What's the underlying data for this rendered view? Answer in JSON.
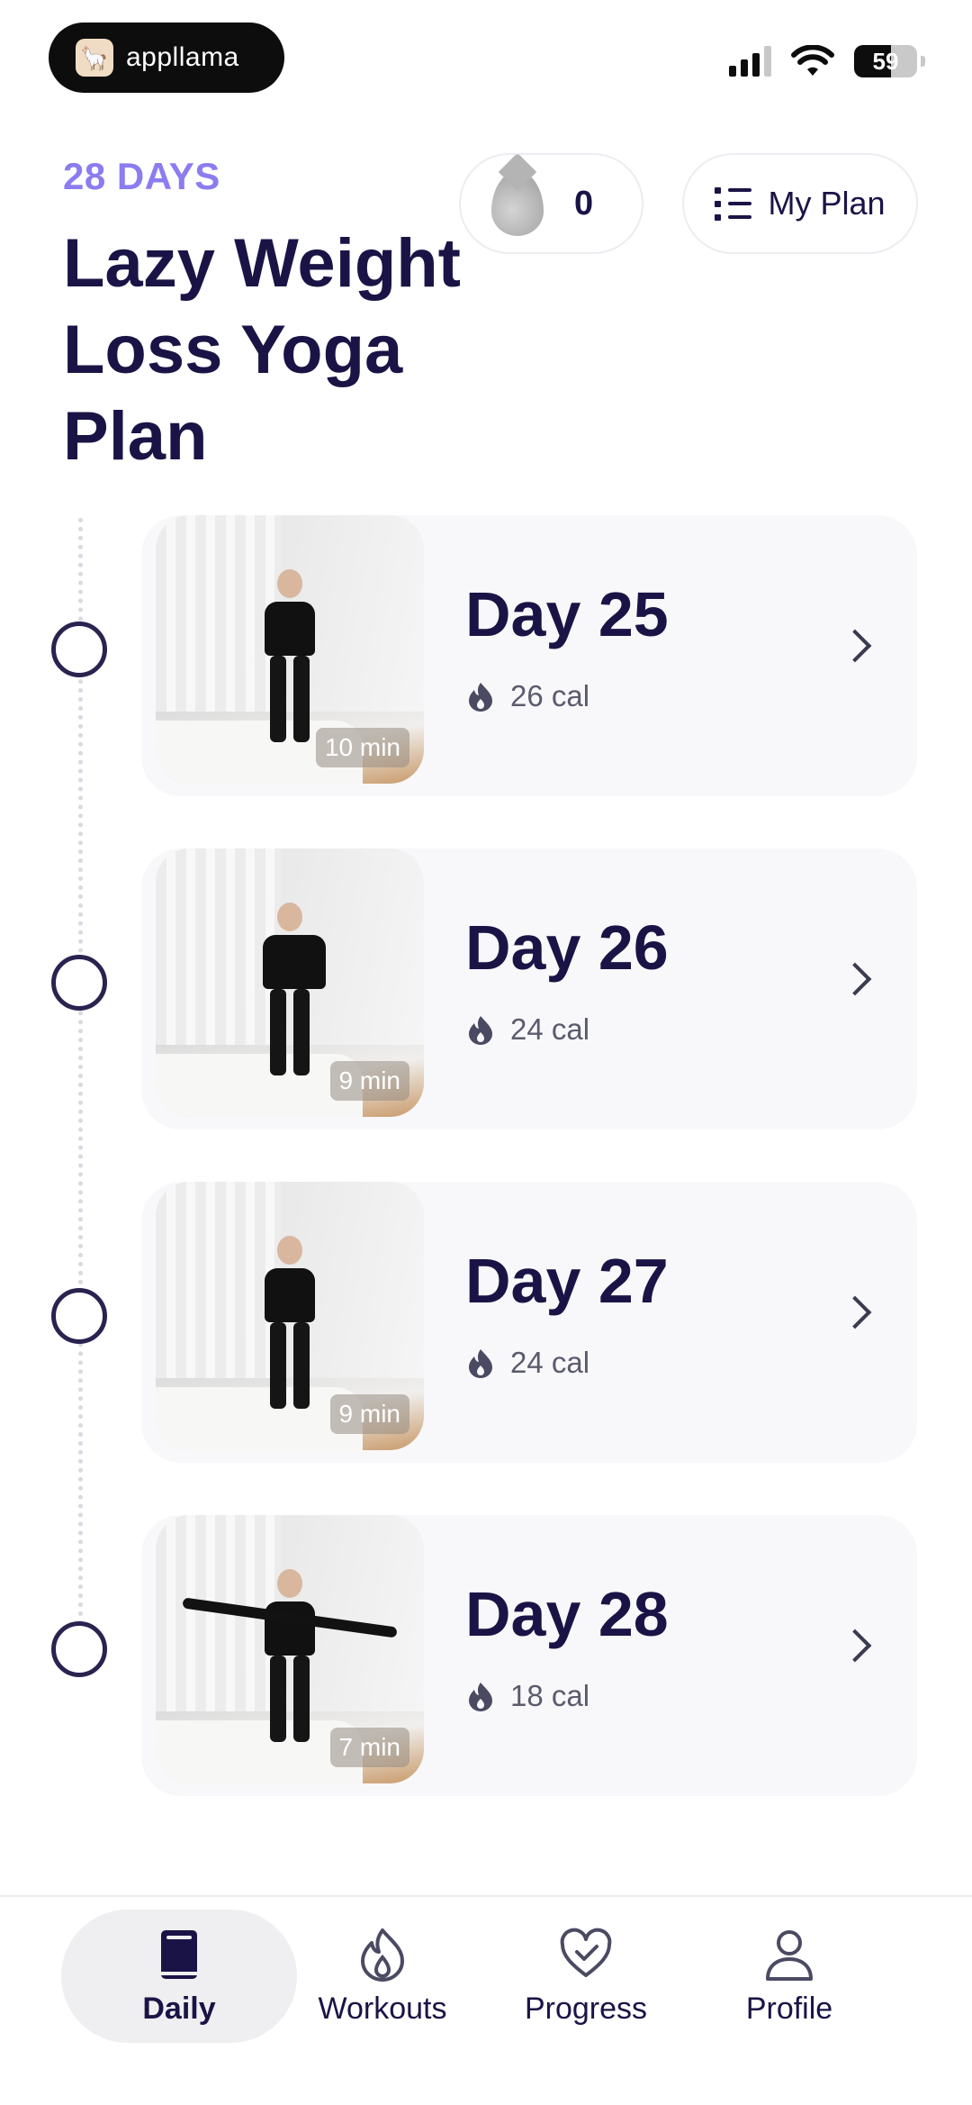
{
  "status_bar": {
    "brand": "appllama",
    "battery_level": "59"
  },
  "header": {
    "duration_label": "28 DAYS",
    "title": "Lazy Weight Loss Yoga Plan",
    "drops_count": "0",
    "my_plan_label": "My Plan"
  },
  "days": [
    {
      "title": "Day 25",
      "calories": "26 cal",
      "duration": "10 min"
    },
    {
      "title": "Day 26",
      "calories": "24 cal",
      "duration": "9 min"
    },
    {
      "title": "Day 27",
      "calories": "24 cal",
      "duration": "9 min"
    },
    {
      "title": "Day 28",
      "calories": "18 cal",
      "duration": "7 min"
    }
  ],
  "bottom_nav": {
    "items": [
      {
        "label": "Daily",
        "icon": "book-icon",
        "active": true
      },
      {
        "label": "Workouts",
        "icon": "flame-icon",
        "active": false
      },
      {
        "label": "Progress",
        "icon": "heart-check-icon",
        "active": false
      },
      {
        "label": "Profile",
        "icon": "person-icon",
        "active": false
      }
    ]
  },
  "colors": {
    "accent": "#8b7cf0",
    "primary_text": "#1a1446",
    "card_bg": "#f8f8fa"
  }
}
